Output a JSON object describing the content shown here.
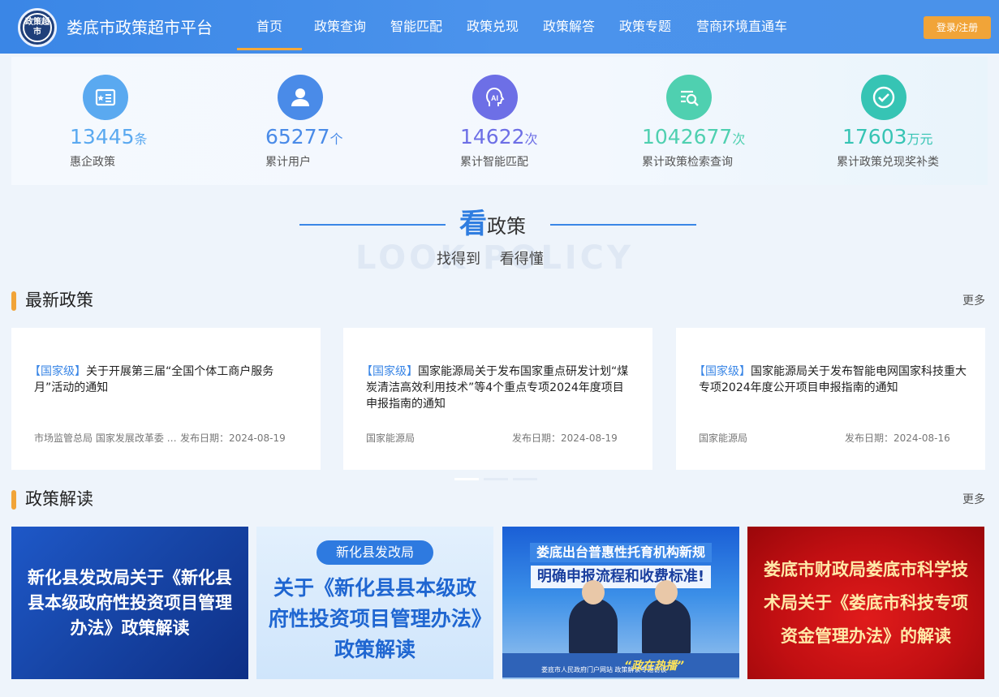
{
  "header": {
    "logo_text": "政策超市",
    "site_title": "娄底市政策超市平台",
    "nav": [
      "首页",
      "政策查询",
      "智能匹配",
      "政策兑现",
      "政策解答",
      "政策专题",
      "营商环境直通车"
    ],
    "login_label": "登录/注册"
  },
  "stats": [
    {
      "value": "13445",
      "unit": "条",
      "label": "惠企政策",
      "color": "#5aa9f0",
      "icon": "policy-book-icon"
    },
    {
      "value": "65277",
      "unit": "个",
      "label": "累计用户",
      "color": "#4a8be8",
      "icon": "user-icon"
    },
    {
      "value": "14622",
      "unit": "次",
      "label": "累计智能匹配",
      "color": "#6d6fe6",
      "icon": "ai-head-icon"
    },
    {
      "value": "1042677",
      "unit": "次",
      "label": "累计政策检索查询",
      "color": "#4fd0b0",
      "icon": "search-list-icon"
    },
    {
      "value": "17603",
      "unit": "万元",
      "label": "累计政策兑现奖补类",
      "color": "#36c4b4",
      "icon": "check-circle-icon"
    }
  ],
  "look": {
    "big_char": "看",
    "rest": "政策",
    "bg_text": "LOOK POLICY",
    "sub": "找得到 看得懂"
  },
  "latest": {
    "title": "最新政策",
    "more": "更多",
    "cards": [
      {
        "tag": "【国家级】",
        "title": "关于开展第三届“全国个体工商户服务月”活动的通知",
        "source": "市场监管总局 国家发展改革委 …",
        "date": "发布日期：2024-08-19"
      },
      {
        "tag": "【国家级】",
        "title": "国家能源局关于发布国家重点研发计划“煤炭清洁高效利用技术”等4个重点专项2024年度项目申报指南的通知",
        "source": "国家能源局",
        "date": "发布日期：2024-08-19"
      },
      {
        "tag": "【国家级】",
        "title": "国家能源局关于发布智能电网国家科技重大专项2024年度公开项目申报指南的通知",
        "source": "国家能源局",
        "date": "发布日期：2024-08-16"
      }
    ]
  },
  "interpret": {
    "title": "政策解读",
    "more": "更多",
    "banner1": "新化县发改局关于《新化县县本级政府性投资项目管理办法》政策解读",
    "banner2_pill": "新化县发改局",
    "banner2": "关于《新化县县本级政府性投资项目管理办法》政策解读",
    "banner3_line1": "娄底出台普惠性托育机构新规",
    "banner3_line2": "明确申报流程和收费标准!",
    "banner3_caption": "娄底市人民政府门户网站 政策解读专题访谈",
    "banner3_slogan": "“政在热播”",
    "banner4": "娄底市财政局娄底市科学技术局关于《娄底市科技专项资金管理办法》的解读"
  }
}
